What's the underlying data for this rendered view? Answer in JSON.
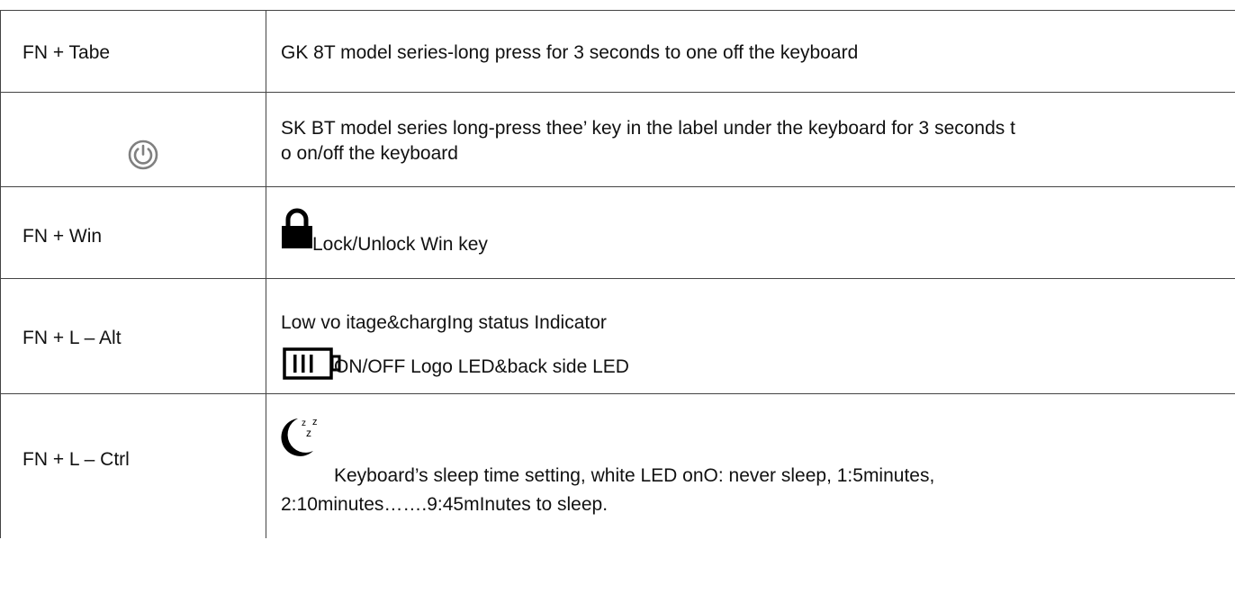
{
  "rows": [
    {
      "key": "FN + Tabe",
      "desc": "GK 8T model series-long press for 3 seconds to one off the keyboard"
    },
    {
      "icon": "power-icon",
      "desc_line1": "SK BT model series long-press thee’ key in the label under the keyboard for 3 seconds t",
      "desc_line2": "o on/off the keyboard"
    },
    {
      "key": "FN + Win",
      "icon": "lock-icon",
      "desc": "Lock/Unlock Win key"
    },
    {
      "key": "FN + L – Alt",
      "desc_line1": "Low vo itage&chargIng status Indicator",
      "icon": "battery-icon",
      "desc_line2": "ON/OFF Logo LED&back side LED"
    },
    {
      "key": "FN + L – Ctrl",
      "icon": "moon-sleep-icon",
      "desc_line1": "Keyboard’s sleep time setting, white LED onO: never sleep, 1:5minutes,",
      "desc_line2": "2:10minutes…….9:45mInutes to sleep."
    }
  ],
  "colors": {
    "border": "#444444",
    "text": "#111111",
    "icon_gray": "#808080",
    "icon_black": "#000000"
  }
}
